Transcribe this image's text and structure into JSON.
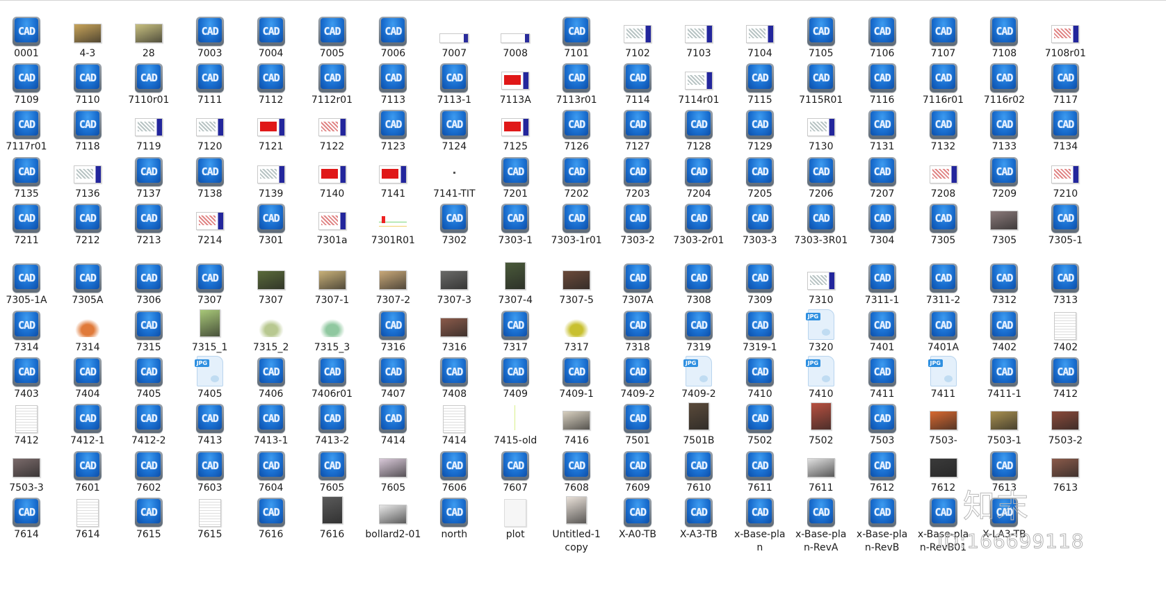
{
  "window": {
    "view": "large-icons",
    "content": "file-list"
  },
  "files": [
    [
      {
        "name": "0001",
        "icon": "cad"
      },
      {
        "name": "4-3",
        "icon": "photo",
        "color": "#c8a45a"
      },
      {
        "name": "28",
        "icon": "photo",
        "color": "#c8c080"
      },
      {
        "name": "7003",
        "icon": "cad"
      },
      {
        "name": "7004",
        "icon": "cad"
      },
      {
        "name": "7005",
        "icon": "cad"
      },
      {
        "name": "7006",
        "icon": "cad"
      },
      {
        "name": "7007",
        "icon": "wide"
      },
      {
        "name": "7008",
        "icon": "wide"
      },
      {
        "name": "7101",
        "icon": "cad"
      },
      {
        "name": "7102",
        "icon": "plan"
      },
      {
        "name": "7103",
        "icon": "plan"
      },
      {
        "name": "7104",
        "icon": "plan"
      },
      {
        "name": "7105",
        "icon": "cad"
      },
      {
        "name": "7106",
        "icon": "cad"
      },
      {
        "name": "7107",
        "icon": "cad"
      },
      {
        "name": "7108",
        "icon": "cad"
      },
      {
        "name": "7108r01",
        "icon": "plan-pink"
      }
    ],
    [
      {
        "name": "7109",
        "icon": "cad"
      },
      {
        "name": "7110",
        "icon": "cad"
      },
      {
        "name": "7110r01",
        "icon": "cad"
      },
      {
        "name": "7111",
        "icon": "cad"
      },
      {
        "name": "7112",
        "icon": "cad"
      },
      {
        "name": "7112r01",
        "icon": "cad"
      },
      {
        "name": "7113",
        "icon": "cad"
      },
      {
        "name": "7113-1",
        "icon": "cad"
      },
      {
        "name": "7113A",
        "icon": "plan-red"
      },
      {
        "name": "7113r01",
        "icon": "cad"
      },
      {
        "name": "7114",
        "icon": "cad"
      },
      {
        "name": "7114r01",
        "icon": "plan"
      },
      {
        "name": "7115",
        "icon": "cad"
      },
      {
        "name": "7115R01",
        "icon": "cad"
      },
      {
        "name": "7116",
        "icon": "cad"
      },
      {
        "name": "7116r01",
        "icon": "cad"
      },
      {
        "name": "7116r02",
        "icon": "cad"
      },
      {
        "name": "7117",
        "icon": "cad"
      }
    ],
    [
      {
        "name": "7117r01",
        "icon": "cad"
      },
      {
        "name": "7118",
        "icon": "cad"
      },
      {
        "name": "7119",
        "icon": "plan"
      },
      {
        "name": "7120",
        "icon": "plan"
      },
      {
        "name": "7121",
        "icon": "plan-red"
      },
      {
        "name": "7122",
        "icon": "plan-pink"
      },
      {
        "name": "7123",
        "icon": "cad"
      },
      {
        "name": "7124",
        "icon": "cad"
      },
      {
        "name": "7125",
        "icon": "plan-red"
      },
      {
        "name": "7126",
        "icon": "cad"
      },
      {
        "name": "7127",
        "icon": "cad"
      },
      {
        "name": "7128",
        "icon": "cad"
      },
      {
        "name": "7129",
        "icon": "cad"
      },
      {
        "name": "7130",
        "icon": "plan"
      },
      {
        "name": "7131",
        "icon": "cad"
      },
      {
        "name": "7132",
        "icon": "cad"
      },
      {
        "name": "7133",
        "icon": "cad"
      },
      {
        "name": "7134",
        "icon": "cad"
      }
    ],
    [
      {
        "name": "7135",
        "icon": "cad"
      },
      {
        "name": "7136",
        "icon": "plan"
      },
      {
        "name": "7137",
        "icon": "cad"
      },
      {
        "name": "7138",
        "icon": "cad"
      },
      {
        "name": "7139",
        "icon": "plan"
      },
      {
        "name": "7140",
        "icon": "plan-red"
      },
      {
        "name": "7141",
        "icon": "plan-red"
      },
      {
        "name": "7141-TIT",
        "icon": "dot"
      },
      {
        "name": "7201",
        "icon": "cad"
      },
      {
        "name": "7202",
        "icon": "cad"
      },
      {
        "name": "7203",
        "icon": "cad"
      },
      {
        "name": "7204",
        "icon": "cad"
      },
      {
        "name": "7205",
        "icon": "cad"
      },
      {
        "name": "7206",
        "icon": "cad"
      },
      {
        "name": "7207",
        "icon": "cad"
      },
      {
        "name": "7208",
        "icon": "plan-pink"
      },
      {
        "name": "7209",
        "icon": "cad"
      },
      {
        "name": "7210",
        "icon": "plan-pink"
      }
    ],
    [
      {
        "name": "7211",
        "icon": "cad"
      },
      {
        "name": "7212",
        "icon": "cad"
      },
      {
        "name": "7213",
        "icon": "cad"
      },
      {
        "name": "7214",
        "icon": "plan-pink"
      },
      {
        "name": "7301",
        "icon": "cad"
      },
      {
        "name": "7301a",
        "icon": "plan-pink"
      },
      {
        "name": "7301R01",
        "icon": "section"
      },
      {
        "name": "7302",
        "icon": "cad"
      },
      {
        "name": "7303-1",
        "icon": "cad"
      },
      {
        "name": "7303-1r01",
        "icon": "cad"
      },
      {
        "name": "7303-2",
        "icon": "cad"
      },
      {
        "name": "7303-2r01",
        "icon": "cad"
      },
      {
        "name": "7303-3",
        "icon": "cad"
      },
      {
        "name": "7303-3R01",
        "icon": "cad"
      },
      {
        "name": "7304",
        "icon": "cad"
      },
      {
        "name": "7305",
        "icon": "cad"
      },
      {
        "name": "7305",
        "icon": "photo",
        "color": "#8a7a7a"
      },
      {
        "name": "7305-1",
        "icon": "cad"
      }
    ],
    [
      {
        "name": "7305-1A",
        "icon": "cad"
      },
      {
        "name": "7305A",
        "icon": "cad"
      },
      {
        "name": "7306",
        "icon": "cad"
      },
      {
        "name": "7307",
        "icon": "cad"
      },
      {
        "name": "7307",
        "icon": "photo",
        "color": "#5a6a3a"
      },
      {
        "name": "7307-1",
        "icon": "photo",
        "color": "#c8b078"
      },
      {
        "name": "7307-2",
        "icon": "photo",
        "color": "#c8a878"
      },
      {
        "name": "7307-3",
        "icon": "photo",
        "color": "#6a6a68"
      },
      {
        "name": "7307-4",
        "icon": "photo-tall",
        "color": "#4a5a3a"
      },
      {
        "name": "7307-5",
        "icon": "photo",
        "color": "#6a4a3a"
      },
      {
        "name": "7307A",
        "icon": "cad"
      },
      {
        "name": "7308",
        "icon": "cad"
      },
      {
        "name": "7309",
        "icon": "cad"
      },
      {
        "name": "7310",
        "icon": "plan"
      },
      {
        "name": "7311-1",
        "icon": "cad"
      },
      {
        "name": "7311-2",
        "icon": "cad"
      },
      {
        "name": "7312",
        "icon": "cad"
      },
      {
        "name": "7313",
        "icon": "cad"
      }
    ],
    [
      {
        "name": "7314",
        "icon": "cad"
      },
      {
        "name": "7314",
        "icon": "map",
        "color": "#e07a3a"
      },
      {
        "name": "7315",
        "icon": "cad"
      },
      {
        "name": "7315_1",
        "icon": "photo-tall",
        "color": "#a8c878"
      },
      {
        "name": "7315_2",
        "icon": "map",
        "color": "#b8c890"
      },
      {
        "name": "7315_3",
        "icon": "map",
        "color": "#90c8a0"
      },
      {
        "name": "7316",
        "icon": "cad"
      },
      {
        "name": "7316",
        "icon": "photo",
        "color": "#8a5a4a"
      },
      {
        "name": "7317",
        "icon": "cad"
      },
      {
        "name": "7317",
        "icon": "map",
        "color": "#c8c030"
      },
      {
        "name": "7318",
        "icon": "cad"
      },
      {
        "name": "7319",
        "icon": "cad"
      },
      {
        "name": "7319-1",
        "icon": "cad"
      },
      {
        "name": "7320",
        "icon": "jpg"
      },
      {
        "name": "7401",
        "icon": "cad"
      },
      {
        "name": "7401A",
        "icon": "cad"
      },
      {
        "name": "7402",
        "icon": "cad"
      },
      {
        "name": "7402",
        "icon": "doc"
      }
    ],
    [
      {
        "name": "7403",
        "icon": "cad"
      },
      {
        "name": "7404",
        "icon": "cad"
      },
      {
        "name": "7405",
        "icon": "cad"
      },
      {
        "name": "7405",
        "icon": "jpg"
      },
      {
        "name": "7406",
        "icon": "cad"
      },
      {
        "name": "7406r01",
        "icon": "cad"
      },
      {
        "name": "7407",
        "icon": "cad"
      },
      {
        "name": "7408",
        "icon": "cad"
      },
      {
        "name": "7409",
        "icon": "cad"
      },
      {
        "name": "7409-1",
        "icon": "cad"
      },
      {
        "name": "7409-2",
        "icon": "cad"
      },
      {
        "name": "7409-2",
        "icon": "jpg"
      },
      {
        "name": "7410",
        "icon": "cad"
      },
      {
        "name": "7410",
        "icon": "jpg"
      },
      {
        "name": "7411",
        "icon": "cad"
      },
      {
        "name": "7411",
        "icon": "jpg"
      },
      {
        "name": "7411-1",
        "icon": "cad"
      },
      {
        "name": "7412",
        "icon": "cad"
      }
    ],
    [
      {
        "name": "7412",
        "icon": "doc"
      },
      {
        "name": "7412-1",
        "icon": "cad"
      },
      {
        "name": "7412-2",
        "icon": "cad"
      },
      {
        "name": "7413",
        "icon": "cad"
      },
      {
        "name": "7413-1",
        "icon": "cad"
      },
      {
        "name": "7413-2",
        "icon": "cad"
      },
      {
        "name": "7414",
        "icon": "cad"
      },
      {
        "name": "7414",
        "icon": "doc"
      },
      {
        "name": "7415-old",
        "icon": "line"
      },
      {
        "name": "7416",
        "icon": "photo",
        "color": "#d8d0c0"
      },
      {
        "name": "7501",
        "icon": "cad"
      },
      {
        "name": "7501B",
        "icon": "photo-tall",
        "color": "#5a4a3a"
      },
      {
        "name": "7502",
        "icon": "cad"
      },
      {
        "name": "7502",
        "icon": "photo-tall",
        "color": "#b85040"
      },
      {
        "name": "7503",
        "icon": "cad"
      },
      {
        "name": "7503-",
        "icon": "photo",
        "color": "#d86830"
      },
      {
        "name": "7503-1",
        "icon": "photo",
        "color": "#a89050"
      },
      {
        "name": "7503-2",
        "icon": "photo",
        "color": "#8a4a3a"
      }
    ],
    [
      {
        "name": "7503-3",
        "icon": "photo",
        "color": "#7a6a6a"
      },
      {
        "name": "7601",
        "icon": "cad"
      },
      {
        "name": "7602",
        "icon": "cad"
      },
      {
        "name": "7603",
        "icon": "cad"
      },
      {
        "name": "7604",
        "icon": "cad"
      },
      {
        "name": "7605",
        "icon": "cad"
      },
      {
        "name": "7605",
        "icon": "photo",
        "color": "#d8c8d8"
      },
      {
        "name": "7606",
        "icon": "cad"
      },
      {
        "name": "7607",
        "icon": "cad"
      },
      {
        "name": "7608",
        "icon": "cad"
      },
      {
        "name": "7609",
        "icon": "cad"
      },
      {
        "name": "7610",
        "icon": "cad"
      },
      {
        "name": "7611",
        "icon": "cad"
      },
      {
        "name": "7611",
        "icon": "photo",
        "color": "#e0e0e0"
      },
      {
        "name": "7612",
        "icon": "cad"
      },
      {
        "name": "7612",
        "icon": "photo",
        "color": "#3a3a3a"
      },
      {
        "name": "7613",
        "icon": "cad"
      },
      {
        "name": "7613",
        "icon": "photo",
        "color": "#8a5a4a"
      }
    ],
    [
      {
        "name": "7614",
        "icon": "cad"
      },
      {
        "name": "7614",
        "icon": "doc"
      },
      {
        "name": "7615",
        "icon": "cad"
      },
      {
        "name": "7615",
        "icon": "doc"
      },
      {
        "name": "7616",
        "icon": "cad"
      },
      {
        "name": "7616",
        "icon": "photo-tall",
        "color": "#5a5a5a"
      },
      {
        "name": "bollard2-01",
        "icon": "photo",
        "color": "#e8e8e8"
      },
      {
        "name": "north",
        "icon": "cad"
      },
      {
        "name": "plot",
        "icon": "blank"
      },
      {
        "name": "Untitled-1 copy",
        "icon": "photo-tall",
        "color": "#e8e0d8"
      },
      {
        "name": "X-A0-TB",
        "icon": "cad"
      },
      {
        "name": "X-A3-TB",
        "icon": "cad"
      },
      {
        "name": "x-Base-plan",
        "icon": "cad"
      },
      {
        "name": "x-Base-plan-RevA",
        "icon": "cad"
      },
      {
        "name": "x-Base-plan-RevB",
        "icon": "cad"
      },
      {
        "name": "x-Base-plan-RevB01",
        "icon": "cad"
      },
      {
        "name": "X-LA3-TB",
        "icon": "cad"
      }
    ]
  ],
  "icons": {
    "cad_glyph": "CAD",
    "jpg_tag": "JPG"
  },
  "watermark": {
    "brand": "知末",
    "id": "ID:166699118"
  }
}
